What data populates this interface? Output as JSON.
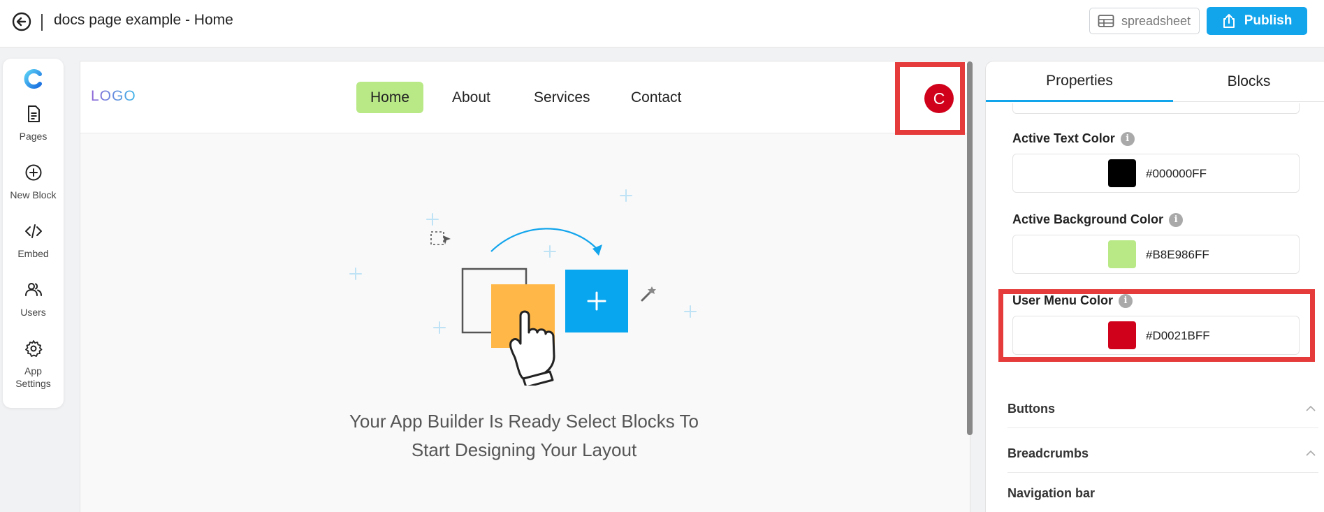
{
  "header": {
    "title": "docs page example - Home",
    "spreadsheet_label": "spreadsheet",
    "publish_label": "Publish"
  },
  "sidebar": {
    "items": [
      {
        "label": "Pages",
        "icon": "document-icon"
      },
      {
        "label": "New Block",
        "icon": "plus-circle-icon"
      },
      {
        "label": "Embed",
        "icon": "code-icon"
      },
      {
        "label": "Users",
        "icon": "users-icon"
      },
      {
        "label": "App Settings",
        "icon": "gear-icon"
      }
    ]
  },
  "canvas": {
    "logo_text": "LOGO",
    "nav_links": [
      "Home",
      "About",
      "Services",
      "Contact"
    ],
    "active_link": "Home",
    "user_initial": "C",
    "empty_message_line1": "Your App Builder Is Ready Select Blocks To",
    "empty_message_line2": "Start Designing Your Layout"
  },
  "panel": {
    "tabs": [
      "Properties",
      "Blocks"
    ],
    "active_tab": "Properties",
    "properties": [
      {
        "label": "Active Text Color",
        "value": "#000000FF",
        "swatch": "#000000"
      },
      {
        "label": "Active Background Color",
        "value": "#B8E986FF",
        "swatch": "#B8E986"
      },
      {
        "label": "User Menu Color",
        "value": "#D0021BFF",
        "swatch": "#D0021B"
      }
    ],
    "sections": [
      "Buttons",
      "Breadcrumbs",
      "Navigation bar"
    ]
  },
  "colors": {
    "accent": "#13A5EC",
    "highlight": "#E53B3B",
    "active_link_bg": "#B8E986",
    "avatar": "#D0021B"
  }
}
